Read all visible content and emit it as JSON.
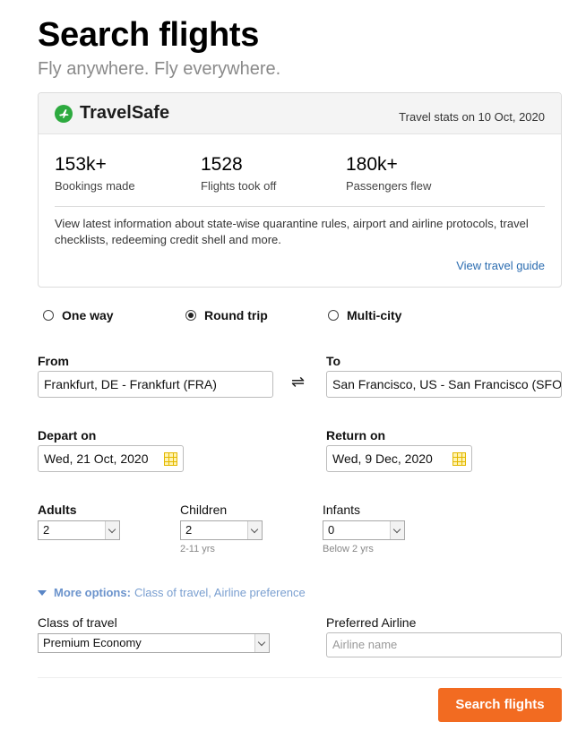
{
  "header": {
    "title": "Search flights",
    "subtitle": "Fly anywhere. Fly everywhere."
  },
  "travelsafe": {
    "brand": "TravelSafe",
    "stats_date": "Travel stats on 10 Oct, 2020",
    "stats": [
      {
        "value": "153k+",
        "label": "Bookings made"
      },
      {
        "value": "1528",
        "label": "Flights took off"
      },
      {
        "value": "180k+",
        "label": "Passengers flew"
      }
    ],
    "description": "View latest information about state-wise quarantine rules, airport and airline protocols, travel checklists, redeeming credit shell and more.",
    "link": "View travel guide"
  },
  "trip_type": {
    "options": [
      "One way",
      "Round trip",
      "Multi-city"
    ],
    "selected": "Round trip"
  },
  "route": {
    "from_label": "From",
    "from_value": "Frankfurt, DE - Frankfurt (FRA)",
    "swap_icon": "⇌",
    "to_label": "To",
    "to_value": "San Francisco, US - San Francisco (SFO)"
  },
  "dates": {
    "depart_label": "Depart on",
    "depart_value": "Wed, 21 Oct, 2020",
    "return_label": "Return on",
    "return_value": "Wed, 9 Dec, 2020"
  },
  "passengers": {
    "adults_label": "Adults",
    "adults_value": "2",
    "children_label": "Children",
    "children_value": "2",
    "children_hint": "2-11 yrs",
    "infants_label": "Infants",
    "infants_value": "0",
    "infants_hint": "Below 2 yrs"
  },
  "more_options": {
    "label": "More options:",
    "detail": "Class of travel, Airline preference"
  },
  "extra": {
    "class_label": "Class of travel",
    "class_value": "Premium Economy",
    "airline_label": "Preferred Airline",
    "airline_placeholder": "Airline name"
  },
  "actions": {
    "search": "Search flights"
  },
  "colors": {
    "accent": "#f26b21",
    "brand_green": "#2daa3f",
    "link": "#2b6cb0"
  }
}
